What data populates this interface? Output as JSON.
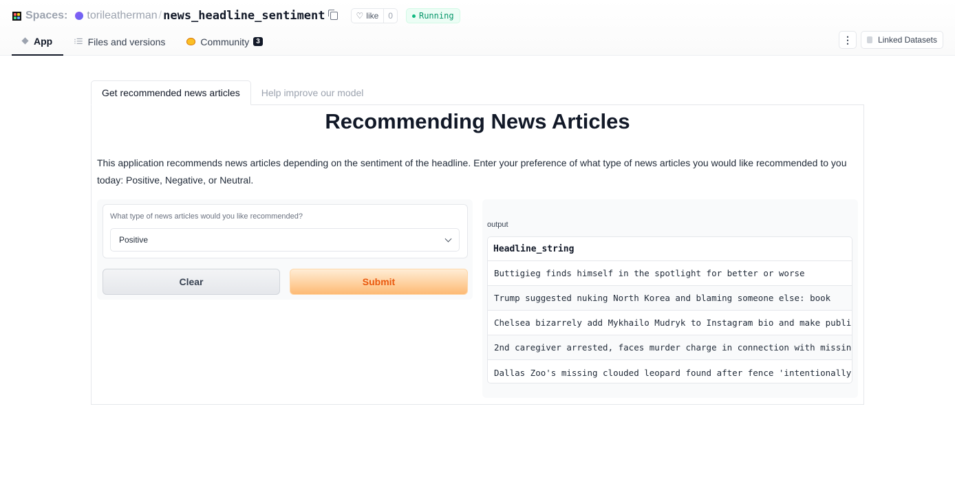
{
  "header": {
    "spaces_label": "Spaces:",
    "owner": "torileatherman",
    "separator": "/",
    "space_name": "news_headline_sentiment",
    "like_label": "like",
    "like_count": "0",
    "status": "Running",
    "linked_datasets_label": "Linked Datasets"
  },
  "nav": {
    "tabs": [
      {
        "label": "App"
      },
      {
        "label": "Files and versions"
      },
      {
        "label": "Community",
        "badge": "3"
      }
    ]
  },
  "app": {
    "tabs": [
      {
        "label": "Get recommended news articles"
      },
      {
        "label": "Help improve our model"
      }
    ],
    "title": "Recommending News Articles",
    "description": "This application recommends news articles depending on the sentiment of the headline. Enter your preference of what type of news articles you would like recommended to you today: Positive, Negative, or Neutral.",
    "dropdown_label": "What type of news articles would you like recommended?",
    "dropdown_value": "Positive",
    "clear_label": "Clear",
    "submit_label": "Submit",
    "output_label": "output",
    "table": {
      "header": "Headline_string",
      "rows": [
        "Buttigieg finds himself in the spotlight for better or worse",
        "Trump suggested nuking North Korea and blaming someone else: book",
        "Chelsea bizarrely add Mykhailo Mudryk to Instagram bio and make publi",
        "2nd caregiver arrested, faces murder charge in connection with missin",
        "Dallas Zoo's missing clouded leopard found after fence 'intentionally"
      ]
    }
  },
  "colors": {
    "status_green": "#059669",
    "submit_orange": "#ea580c"
  }
}
